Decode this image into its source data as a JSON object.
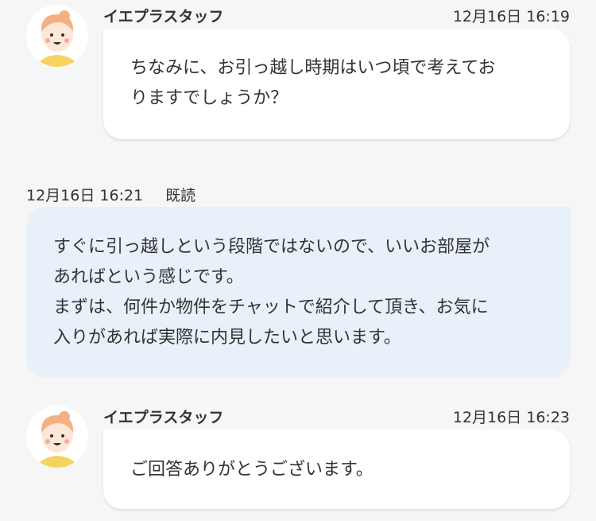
{
  "messages": [
    {
      "sender": "イエプラスタッフ",
      "time": "12月16日 16:19",
      "lines": [
        "ちなみに、お引っ越し時期はいつ頃で考えてお",
        "りますでしょうか？"
      ]
    },
    {
      "time": "12月16日 16:21",
      "status": "既読",
      "lines": [
        "すぐに引っ越しという段階ではないので、いいお部屋が",
        "あればという感じです。",
        "まずは、何件か物件をチャットで紹介して頂き、お気に",
        "入りがあれば実際に内見したいと思います。"
      ]
    },
    {
      "sender": "イエプラスタッフ",
      "time": "12月16日 16:23",
      "lines": [
        "ご回答ありがとうございます。"
      ]
    }
  ]
}
